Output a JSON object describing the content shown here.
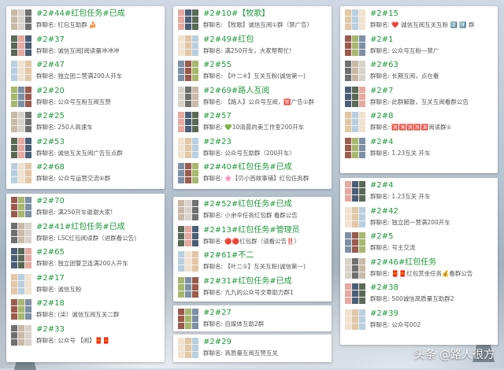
{
  "columns": [
    [
      {
        "items": [
          {
            "title": "#2#44#红包任务#已成",
            "sub": "群聊名: 红包互助群 🍰"
          },
          {
            "title": "#2#37",
            "sub": "群聊名: 诚信互阅[阅读量冲冲冲"
          },
          {
            "title": "#2#47",
            "sub": "群聊名: 独立团二营满200人开车"
          },
          {
            "title": "#2#20",
            "sub": "群聊名: 公众号互粉互阅互赞"
          },
          {
            "title": "#2#25",
            "sub": "群聊名: 250人高速车"
          },
          {
            "title": "#2#53",
            "sub": "群聊名: 诚信互关互阅广告互点群"
          },
          {
            "title": "#2#68",
            "sub": "群聊名: 公众号运营交流⑥群"
          }
        ]
      },
      {
        "items": [
          {
            "title": "#2#70",
            "sub": "群聊名: 满250开车谢谢大家!"
          },
          {
            "title": "#2#41#红包任务#已成",
            "sub": "群聊名: LSC红包阅读群（进群看公告)"
          },
          {
            "title": "#2#65",
            "sub": "群聊名: 独立团警卫连满200人开车"
          },
          {
            "title": "#2#17",
            "sub": "群聊名: 诚信互粉"
          },
          {
            "title": "#2#18",
            "sub": "群聊名: (柒）诚信互阅互关二群"
          },
          {
            "title": "#2#33",
            "sub": "群聊名: 公众号 【阅】🧧🧧"
          }
        ]
      }
    ],
    [
      {
        "items": [
          {
            "title": "#2#10#【牧歌】",
            "sub": "群聊名: 【牧歌】诚信互阅①群（禁广告）"
          },
          {
            "title": "#2#49#红包",
            "sub": "群聊名: 满250开车，大家帮帮忙!"
          },
          {
            "title": "#2#55",
            "sub": "群聊名: 【叶二④】互关互粉(诚信第一)"
          },
          {
            "title": "#2#69#路人互阅",
            "sub": "群聊名: 【路人】公众号互阅，🈲广告①群"
          },
          {
            "title": "#2#57",
            "sub": "群聊名: 💚10清晨的美工作室200开车"
          },
          {
            "title": "#2#23",
            "sub": "群聊名: 公众号互助群（200开车）"
          },
          {
            "title": "#2#40#红包任务#已成",
            "sub": "群聊名: 🌸【贝小西故事铺】红包任务群"
          }
        ]
      },
      {
        "items": [
          {
            "title": "#2#52#红包任务#已成",
            "sub": "群聊名: 小余伞任务红包群 看群公告"
          },
          {
            "title": "#2#13#红包任务#管理员",
            "sub": "群聊名: 🔴🔴红包群（请看公告‼️）"
          },
          {
            "title": "#2#61#不二",
            "sub": "群聊名: 【叶二①】互关互粉(诚信第一)"
          },
          {
            "title": "#2#31#红包任务#已成",
            "sub": "群聊名: 九九的公众号文章助力群1"
          }
        ]
      },
      {
        "items": [
          {
            "title": "#2#27",
            "sub": "群聊名: 自媒体互助2群"
          }
        ]
      },
      {
        "items": [
          {
            "title": "#2#29",
            "sub": "群聊名: 高质量互阅互赞互关"
          }
        ]
      }
    ],
    [
      {
        "items": [
          {
            "title": "#2#15",
            "sub": "群聊名: ❤️ 诚信互阅互关互粉 2️⃣ 9️⃣ 群"
          },
          {
            "title": "#2#1",
            "sub": "群聊名: 公众号互粉—禁广"
          },
          {
            "title": "#2#63",
            "sub": "群聊名: 长期互阅，点在看"
          },
          {
            "title": "#2#7",
            "sub": "群聊名: 此群解散，互关互阅看群公告"
          },
          {
            "title": "#2#8",
            "sub": "群聊名: 🈵🈵🈵🈵🈵阅读群①"
          },
          {
            "title": "#2#4",
            "sub": "群聊名: 1.23互关 开车"
          }
        ]
      },
      {
        "items": [
          {
            "title": "#2#4",
            "sub": "群聊名: 1.23互关 开车"
          },
          {
            "title": "#2#42",
            "sub": "群聊名: 独立团一营满200开车"
          },
          {
            "title": "#2#5",
            "sub": "群聊名: 号主交流"
          },
          {
            "title": "#2#46#红包任务",
            "sub": "群聊名: 🧧🧧红包赏金任务💰看群公告"
          },
          {
            "title": "#2#38",
            "sub": "群聊名: 500诚信高质量互助群2"
          },
          {
            "title": "#2#39",
            "sub": "群聊名: 公众号002"
          }
        ]
      }
    ]
  ],
  "watermark": "头条 @路人很方",
  "colors": {
    "title": "#1c9a3a",
    "panel": "#ffffff"
  }
}
